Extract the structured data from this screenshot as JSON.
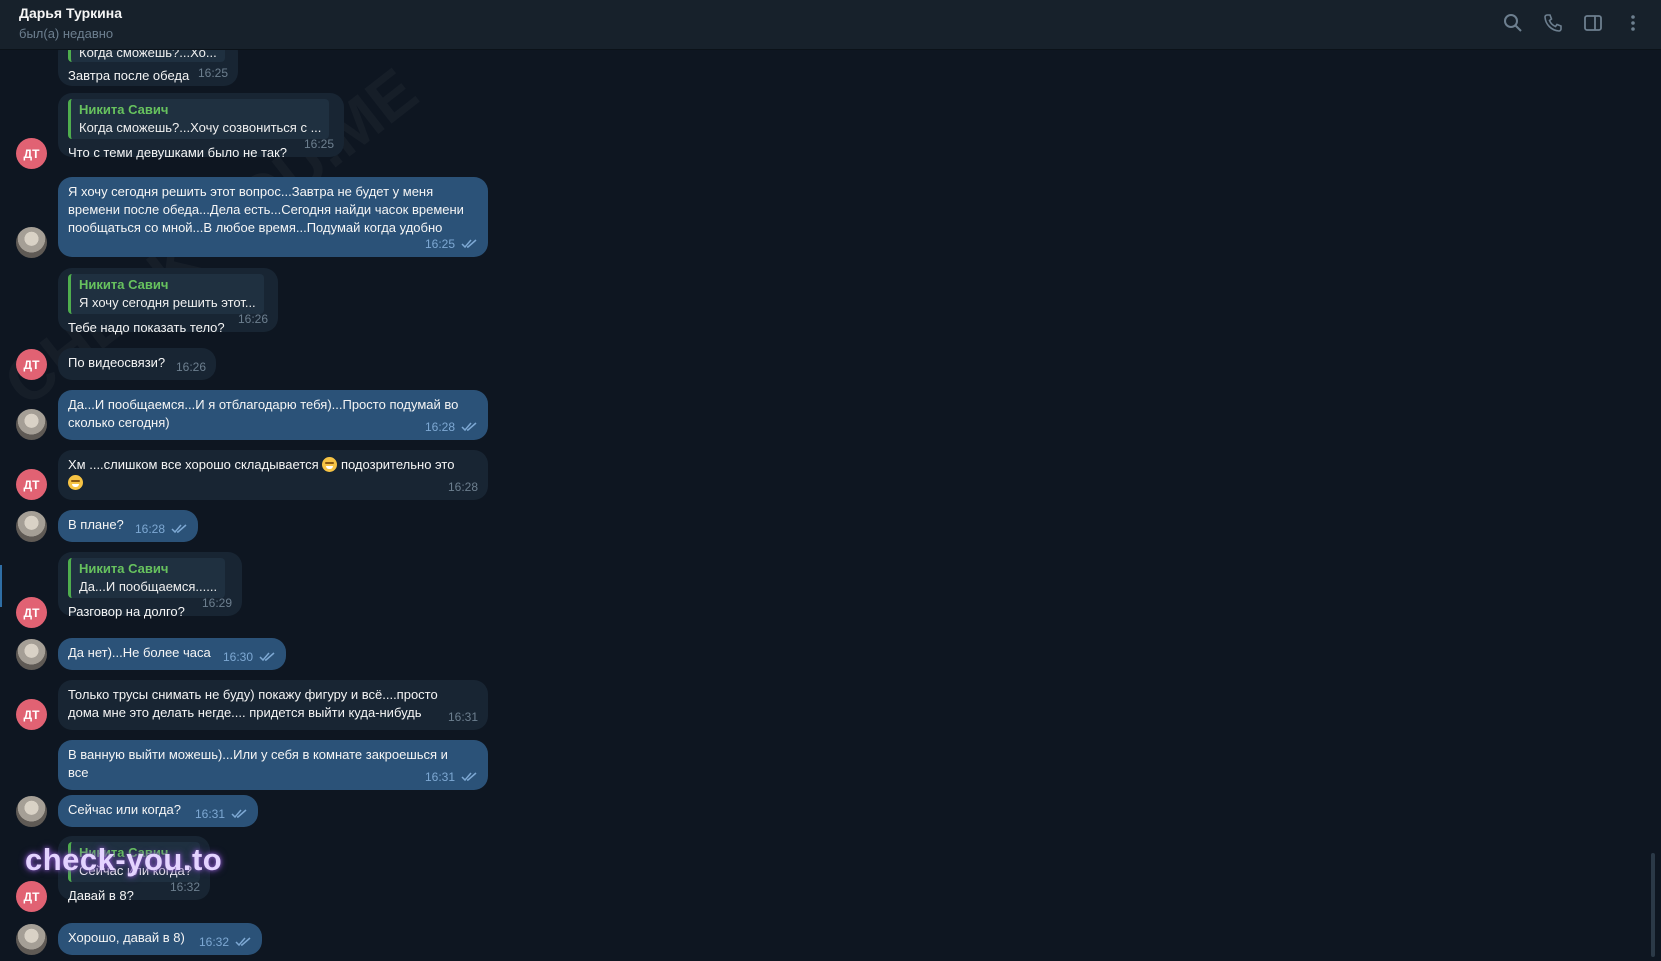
{
  "header": {
    "name": "Дарья Туркина",
    "status": "был(а) недавно"
  },
  "avatar_initials": "ДТ",
  "watermark": "check-you.to",
  "diagonal_watermark": "CHECK-YOU.ME",
  "messages": [
    {
      "reply_text": "Когда сможешь?...Хо...",
      "text": "Завтра после обеда",
      "time": "16:25"
    },
    {
      "reply_name": "Никита Савич",
      "reply_text": "Когда сможешь?...Хочу созвониться с ...",
      "text": "Что с теми девушками было не так?",
      "time": "16:25"
    },
    {
      "text": "Я хочу сегодня решить этот вопрос...Завтра не будет у меня\nвремени после обеда...Дела есть...Сегодня найди часок времени\nпообщаться со мной...В любое время...Подумай когда удобно",
      "time": "16:25"
    },
    {
      "reply_name": "Никита Савич",
      "reply_text": "Я хочу сегодня решить этот...",
      "text": "Тебе надо показать тело?",
      "time": "16:26"
    },
    {
      "text": "По видеосвязи?",
      "time": "16:26"
    },
    {
      "text": "Да...И пообщаемся...И я отблагодарю тебя)...Просто подумай во\nсколько сегодня)",
      "time": "16:28"
    },
    {
      "text_a": "Хм ....слишком все хорошо складывается",
      "text_b": "подозрительно это",
      "time": "16:28"
    },
    {
      "text": "В плане?",
      "time": "16:28"
    },
    {
      "reply_name": "Никита Савич",
      "reply_text": "Да...И пообщаемся......",
      "text": "Разговор на долго?",
      "time": "16:29"
    },
    {
      "text": "Да нет)...Не более часа",
      "time": "16:30"
    },
    {
      "text": "Только трусы снимать не буду) покажу фигуру и всё....просто\nдома мне это делать негде.... придется выйти куда-нибудь",
      "time": "16:31"
    },
    {
      "text": "В ванную выйти можешь)...Или у себя в комнате закроешься и\nвсе",
      "time": "16:31"
    },
    {
      "text": "Сейчас или когда?",
      "time": "16:31"
    },
    {
      "reply_name": "Никита Савич",
      "reply_text": "Сейчас или когда?",
      "text": "Давай в 8?",
      "time": "16:32"
    },
    {
      "text": "Хорошо, давай в 8)",
      "time": "16:32"
    }
  ]
}
